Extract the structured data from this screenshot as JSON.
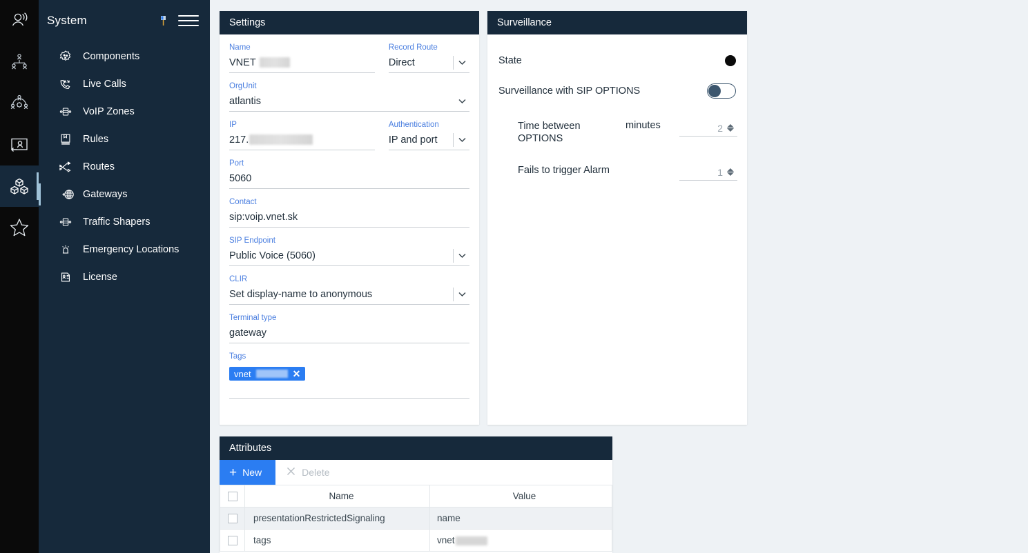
{
  "colors": {
    "nav_bg": "#16293b",
    "rail_bg": "#0a0a0a",
    "accent_blue": "#2b7df2",
    "label_blue": "#4b7fe0",
    "page_bg": "#eef2f5",
    "active_indicator": "#9fc2d8"
  },
  "rail": {
    "items": [
      {
        "icon": "user-headset-icon",
        "active": false
      },
      {
        "icon": "org-hierarchy-icon",
        "active": false
      },
      {
        "icon": "user-group-settings-icon",
        "active": false
      },
      {
        "icon": "desktop-user-icon",
        "active": false
      },
      {
        "icon": "system-blocks-icon",
        "active": true
      },
      {
        "icon": "star-icon",
        "active": false
      }
    ]
  },
  "sidebar": {
    "title": "System",
    "pin_icon": "pin-icon",
    "menu_icon": "hamburger-menu-icon",
    "items": [
      {
        "label": "Components",
        "icon": "components-gear-icon",
        "active": false
      },
      {
        "label": "Live Calls",
        "icon": "live-calls-phone-icon",
        "active": false
      },
      {
        "label": "VoIP Zones",
        "icon": "voip-zones-icon",
        "active": false
      },
      {
        "label": "Rules",
        "icon": "rules-book-icon",
        "active": false
      },
      {
        "label": "Routes",
        "icon": "routes-icon",
        "active": false
      },
      {
        "label": "Gateways",
        "icon": "gateways-globe-icon",
        "active": true
      },
      {
        "label": "Traffic Shapers",
        "icon": "traffic-shapers-icon",
        "active": false
      },
      {
        "label": "Emergency Locations",
        "icon": "emergency-location-icon",
        "active": false
      },
      {
        "label": "License",
        "icon": "license-card-icon",
        "active": false
      }
    ]
  },
  "settings": {
    "title": "Settings",
    "fields": {
      "name": {
        "label": "Name",
        "value": "VNET",
        "redacted": true
      },
      "record_route": {
        "label": "Record Route",
        "value": "Direct"
      },
      "orgunit": {
        "label": "OrgUnit",
        "value": "atlantis"
      },
      "ip": {
        "label": "IP",
        "value": "217.",
        "redacted": true
      },
      "authentication": {
        "label": "Authentication",
        "value": "IP and port"
      },
      "port": {
        "label": "Port",
        "value": "5060"
      },
      "contact": {
        "label": "Contact",
        "value": "sip:voip.vnet.sk"
      },
      "sip_endpoint": {
        "label": "SIP Endpoint",
        "value": "Public Voice (5060)"
      },
      "clir": {
        "label": "CLIR",
        "value": "Set display-name to anonymous"
      },
      "terminal_type": {
        "label": "Terminal type",
        "value": "gateway"
      },
      "tags": {
        "label": "Tags",
        "chip_text": "vnet",
        "chip_remove": "✕"
      }
    }
  },
  "surveillance": {
    "title": "Surveillance",
    "state": {
      "label": "State",
      "indicator": "state-dot-off"
    },
    "sip_options": {
      "label": "Surveillance with SIP OPTIONS",
      "enabled": false
    },
    "time_between": {
      "label": "Time between OPTIONS",
      "unit": "minutes",
      "value": "2"
    },
    "fails_to_alarm": {
      "label": "Fails to trigger Alarm",
      "value": "1"
    }
  },
  "attributes": {
    "title": "Attributes",
    "toolbar": {
      "new_label": "New",
      "delete_label": "Delete"
    },
    "columns": [
      "Name",
      "Value"
    ],
    "rows": [
      {
        "name": "presentationRestrictedSignaling",
        "value": "name",
        "redacted": false
      },
      {
        "name": "tags",
        "value": "vnet",
        "redacted": true
      }
    ]
  }
}
